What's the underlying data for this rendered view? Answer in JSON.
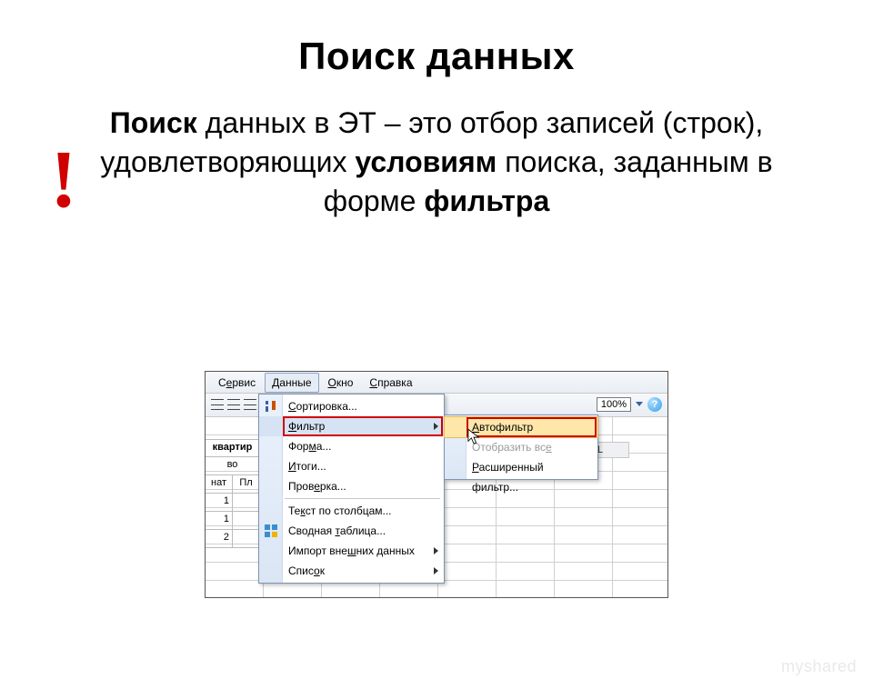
{
  "title": "Поиск данных",
  "exclaim": "!",
  "definition": {
    "b1": "Поиск",
    "t1": " данных в ЭТ – это отбор записей (строк), удовлетворяющих ",
    "b2": "условиям",
    "t2": " поиска, заданным в форме ",
    "b3": "фильтра"
  },
  "menubar": {
    "service": "Сервис",
    "service_u": "е",
    "data": "Данные",
    "data_u": "Д",
    "window": "Окно",
    "window_u": "О",
    "help": "Справка",
    "help_u": "С"
  },
  "toolbar": {
    "zoom": "100%",
    "help_icon": "?"
  },
  "grid": {
    "col_L": "L",
    "left_header": "квартир",
    "left_sub1": "во",
    "left_sub2": "нат",
    "left_sub3": "Пл",
    "r1": "1",
    "r2": "1",
    "r3": "2"
  },
  "dmenu": {
    "sort": "Сортировка...",
    "filter": "Фильтр",
    "form": "Форма...",
    "totals": "Итоги...",
    "validate": "Проверка...",
    "textcols": "Текст по столбцам...",
    "pivot": "Сводная таблица...",
    "import": "Импорт внешних данных",
    "list": "Список"
  },
  "submenu": {
    "autofilter": "Автофильтр",
    "showall": "Отобразить все",
    "advanced": "Расширенный фильтр..."
  },
  "watermark": "myshared"
}
